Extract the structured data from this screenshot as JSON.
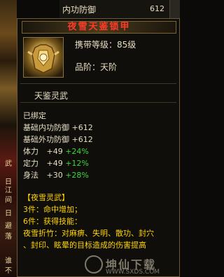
{
  "background": {
    "left_panel_texts": [
      "武",
      "日",
      "江",
      "间",
      "日",
      "避",
      "落",
      "谁",
      "不"
    ],
    "top_row": {
      "label": "内功防御",
      "value": "612"
    }
  },
  "tooltip": {
    "title": "夜雪天鉴锁甲",
    "level_req": "携带等级：85级",
    "rank": "品阶：天阶",
    "secondary_name": "天鉴灵武",
    "bound": "已绑定",
    "base_stats": [
      {
        "label": "基础内功防御",
        "value": "+612"
      },
      {
        "label": "基础外功防御",
        "value": "+612"
      }
    ],
    "bonus_stats": [
      {
        "label": "体力",
        "value": "+49",
        "pct": "+24%"
      },
      {
        "label": "定力",
        "value": "+49",
        "pct": "+12%"
      },
      {
        "label": "身法",
        "value": "+30",
        "pct": "+28%"
      }
    ],
    "set": {
      "name": "【夜雪灵武】",
      "bonuses": [
        "3件：命中增加；",
        "6件：获得技能："
      ],
      "skill_desc": [
        "夜雪折竹：对麻痹、失明、散功、封穴",
        "、封印、眩晕的目标造成的伤害提高"
      ]
    }
  },
  "watermark": {
    "text": "坤仙下载",
    "url": "WWW.SXDS.COM"
  },
  "colors": {
    "title": "#ff3a2a",
    "gold": "#ffd400",
    "green": "#3cd63c",
    "text": "#e6dcc2",
    "border": "#6d5a34"
  }
}
